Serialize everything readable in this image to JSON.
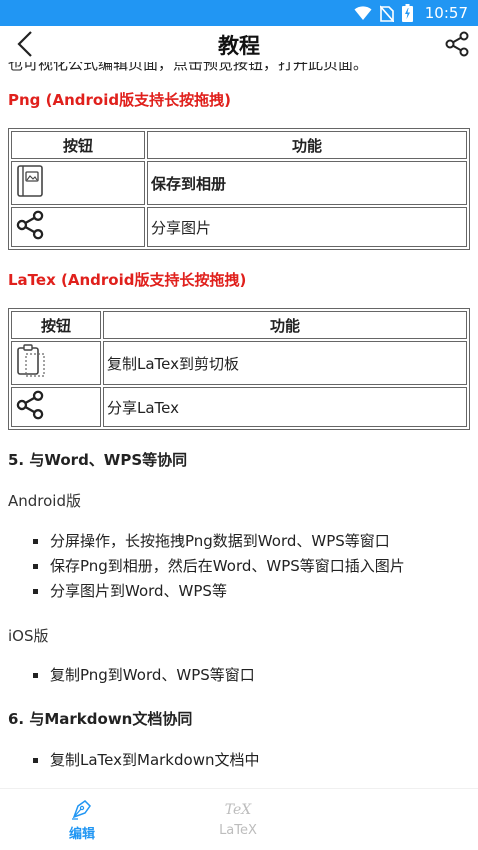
{
  "status_bar": {
    "time": "10:57"
  },
  "app_bar": {
    "title": "教程"
  },
  "content": {
    "cut_off_line": "也可视化公式编辑页面，点击预览按钮，打开此页面。",
    "png_section": {
      "title": "Png (Android版支持长按拖拽)",
      "table": {
        "headers": [
          "按钮",
          "功能"
        ],
        "rows": [
          {
            "icon": "album-save-icon",
            "function": "保存到相册"
          },
          {
            "icon": "share-icon",
            "function": "分享图片"
          }
        ]
      }
    },
    "latex_section": {
      "title": "LaTex (Android版支持长按拖拽)",
      "table": {
        "headers": [
          "按钮",
          "功能"
        ],
        "rows": [
          {
            "icon": "clipboard-icon",
            "function": "复制LaTex到剪切板"
          },
          {
            "icon": "share-icon",
            "function": "分享LaTex"
          }
        ]
      }
    },
    "word_section": {
      "title": "5. 与Word、WPS等协同",
      "android_label": "Android版",
      "android_items": [
        "分屏操作，长按拖拽Png数据到Word、WPS等窗口",
        "保存Png到相册，然后在Word、WPS等窗口插入图片",
        "分享图片到Word、WPS等"
      ],
      "ios_label": "iOS版",
      "ios_items": [
        "复制Png到Word、WPS等窗口"
      ]
    },
    "markdown_section": {
      "title": "6. 与Markdown文档协同",
      "items": [
        "复制LaTex到Markdown文档中"
      ]
    }
  },
  "bottom_nav": {
    "items": [
      {
        "label": "编辑",
        "icon": "pen-nib-icon",
        "active": true
      },
      {
        "label": "LaTeX",
        "icon": "tex-icon",
        "icon_text": "TeX",
        "active": false
      }
    ]
  },
  "colors": {
    "status_bar": "#2196f3",
    "section_title": "#e0201c",
    "nav_active": "#2196f3",
    "nav_inactive": "#bdbdbd"
  }
}
